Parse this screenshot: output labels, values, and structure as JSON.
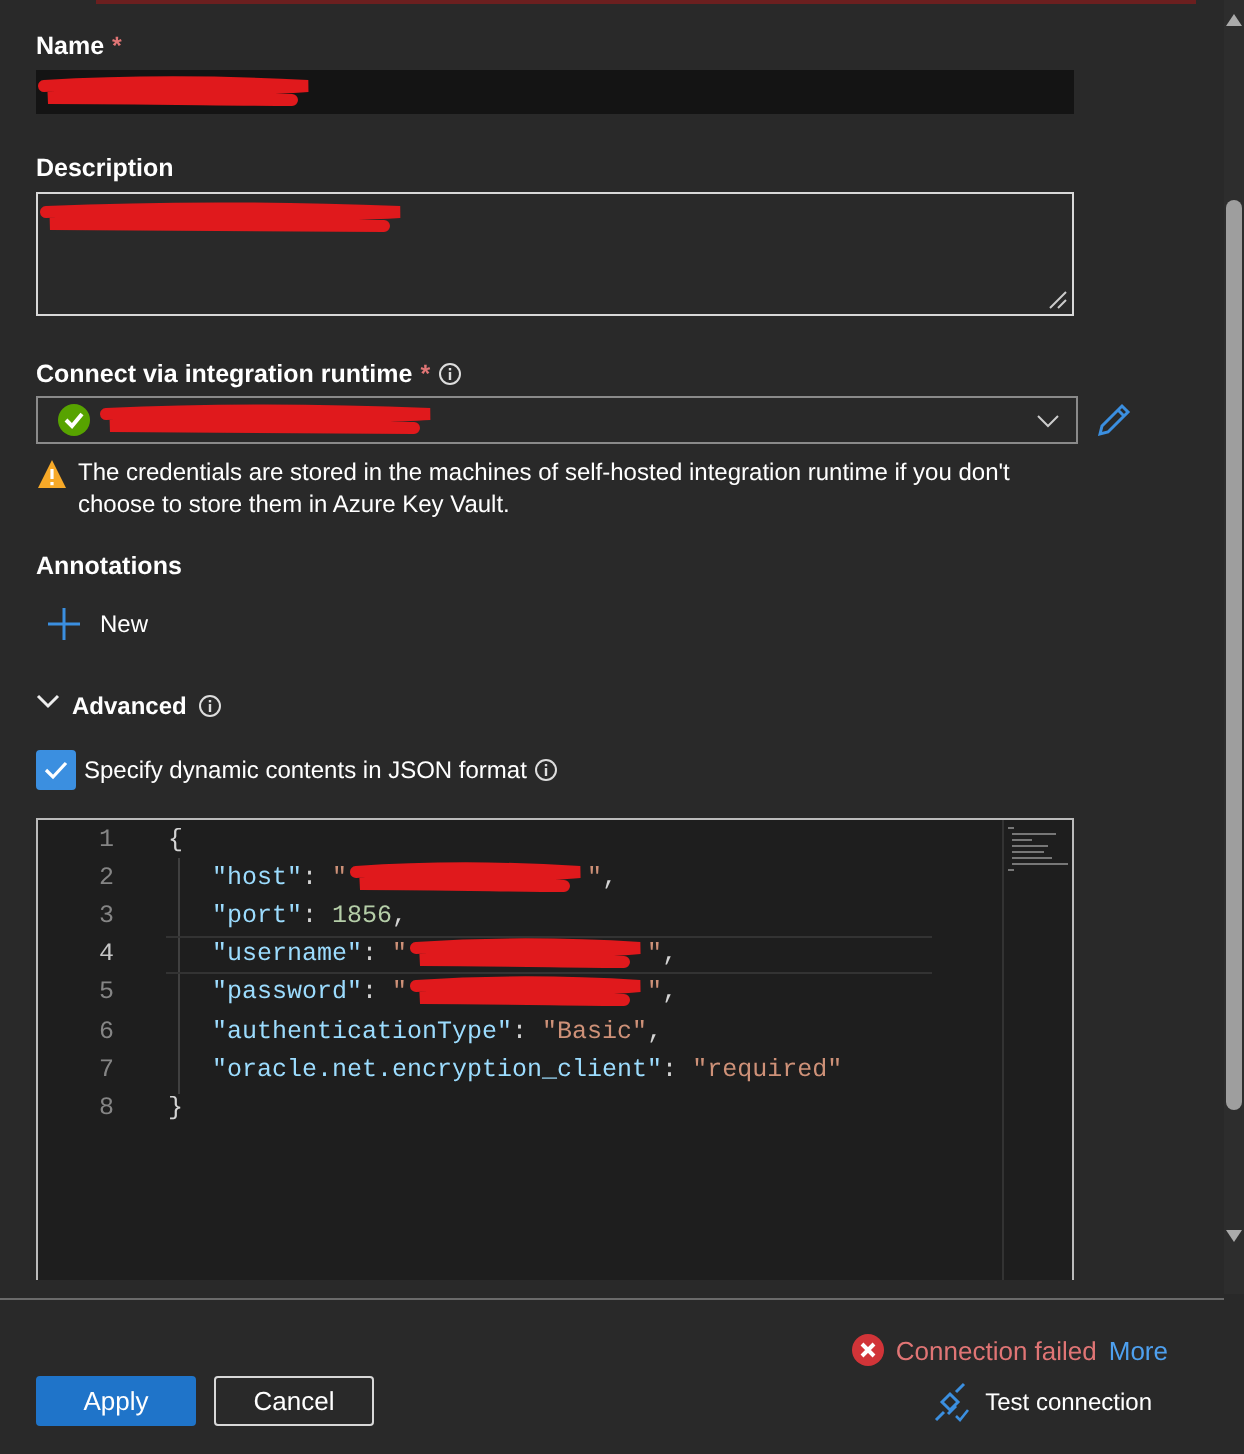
{
  "name_field": {
    "label": "Name",
    "required_mark": "*",
    "redacted": true
  },
  "description_field": {
    "label": "Description",
    "redacted": true
  },
  "runtime_field": {
    "label": "Connect via integration runtime",
    "required_mark": "*",
    "connected": true,
    "redacted": true
  },
  "warning": "The credentials are stored in the machines of self-hosted integration runtime if you don't choose to store them in Azure Key Vault.",
  "annotations": {
    "label": "Annotations",
    "new_button": "New"
  },
  "advanced": {
    "label": "Advanced",
    "expanded": true
  },
  "dynamic_json": {
    "label": "Specify dynamic contents in JSON format",
    "checked": true
  },
  "editor": {
    "lines": [
      {
        "number": "1",
        "current": false,
        "parts": [
          {
            "kind": "punct",
            "text": "{"
          }
        ]
      },
      {
        "number": "2",
        "current": false,
        "parts": [
          {
            "kind": "key",
            "text": "\"host\""
          },
          {
            "kind": "punct",
            "text": ": "
          },
          {
            "kind": "string",
            "text": "\""
          },
          {
            "kind": "redacted"
          },
          {
            "kind": "string",
            "text": "\""
          },
          {
            "kind": "punct",
            "text": ","
          }
        ]
      },
      {
        "number": "3",
        "current": false,
        "parts": [
          {
            "kind": "key",
            "text": "\"port\""
          },
          {
            "kind": "punct",
            "text": ": "
          },
          {
            "kind": "number",
            "text": "1856"
          },
          {
            "kind": "punct",
            "text": ","
          }
        ]
      },
      {
        "number": "4",
        "current": true,
        "parts": [
          {
            "kind": "key",
            "text": "\"username\""
          },
          {
            "kind": "punct",
            "text": ": "
          },
          {
            "kind": "string",
            "text": "\""
          },
          {
            "kind": "redacted"
          },
          {
            "kind": "string",
            "text": "\""
          },
          {
            "kind": "punct",
            "text": ","
          }
        ]
      },
      {
        "number": "5",
        "current": false,
        "parts": [
          {
            "kind": "key",
            "text": "\"password\""
          },
          {
            "kind": "punct",
            "text": ": "
          },
          {
            "kind": "string",
            "text": "\""
          },
          {
            "kind": "redacted"
          },
          {
            "kind": "string",
            "text": "\""
          },
          {
            "kind": "punct",
            "text": ","
          }
        ]
      },
      {
        "number": "6",
        "current": false,
        "parts": [
          {
            "kind": "key",
            "text": "\"authenticationType\""
          },
          {
            "kind": "punct",
            "text": ": "
          },
          {
            "kind": "string",
            "text": "\"Basic\""
          },
          {
            "kind": "punct",
            "text": ","
          }
        ]
      },
      {
        "number": "7",
        "current": false,
        "parts": [
          {
            "kind": "key",
            "text": "\"oracle.net.encryption_client\""
          },
          {
            "kind": "punct",
            "text": ": "
          },
          {
            "kind": "string",
            "text": "\"required\""
          }
        ]
      },
      {
        "number": "8",
        "current": false,
        "parts": [
          {
            "kind": "punct",
            "text": "}"
          }
        ]
      }
    ]
  },
  "status": {
    "kind": "error",
    "text": "Connection failed",
    "link": "More"
  },
  "buttons": [
    {
      "label": "Apply",
      "kind": "primary"
    },
    {
      "label": "Cancel",
      "kind": "secondary"
    }
  ],
  "test_connection": "Test connection"
}
